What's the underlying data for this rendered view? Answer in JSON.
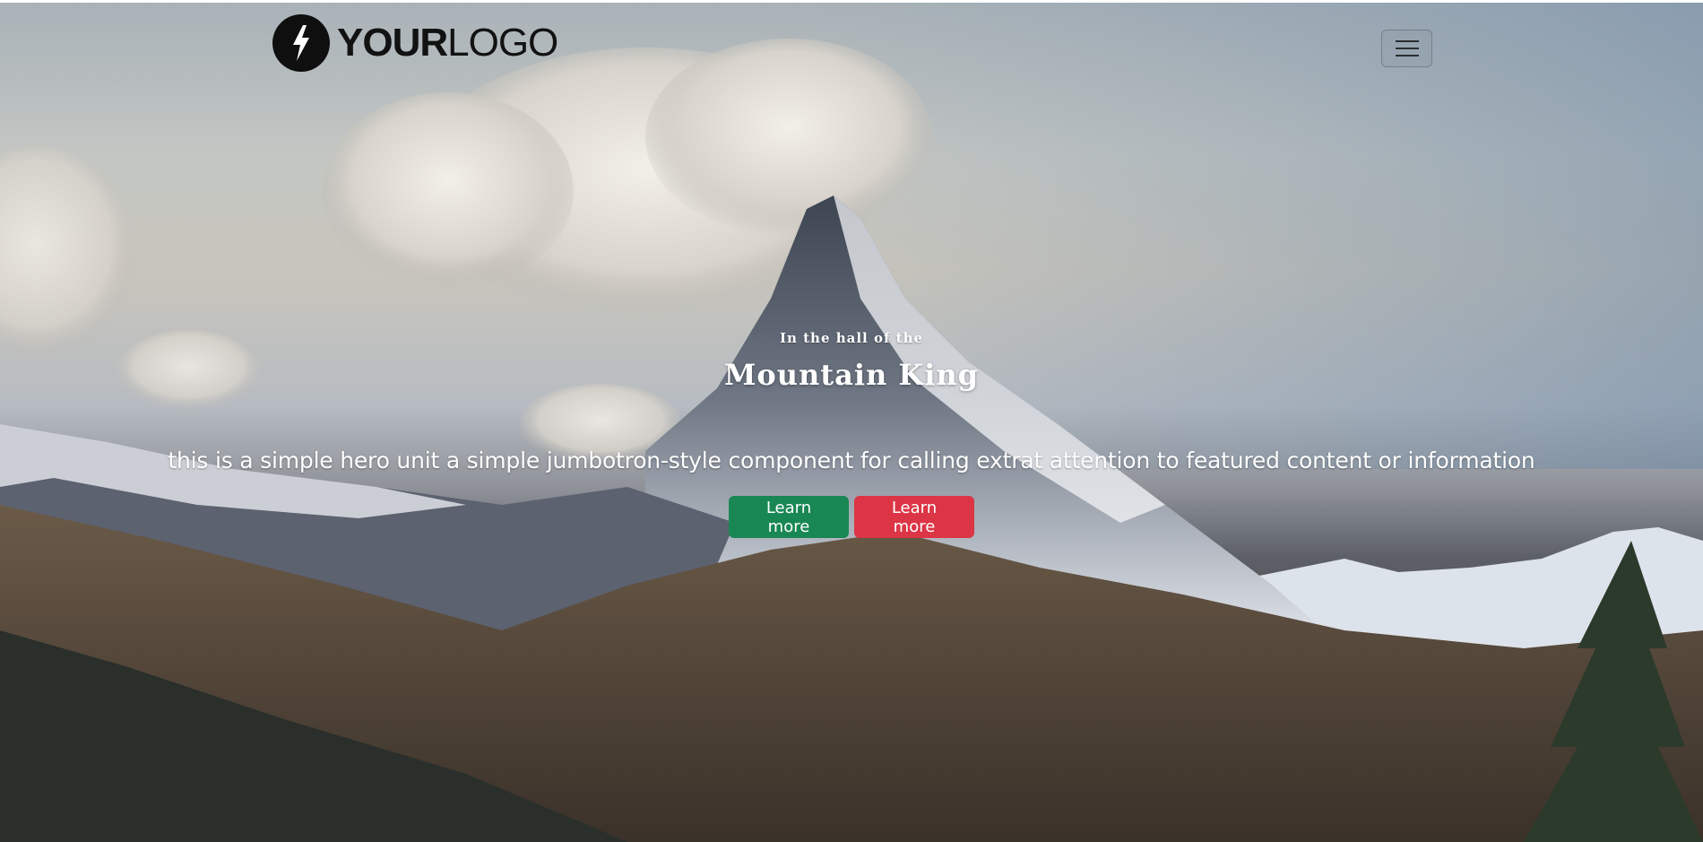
{
  "navbar": {
    "logo": {
      "text_bold": "YOUR",
      "text_light": "LOGO",
      "icon": "lightning-bolt-icon"
    },
    "menu_toggle": {
      "icon": "hamburger-menu-icon"
    }
  },
  "hero": {
    "eyebrow": "In the hall of the",
    "title": "Mountain King",
    "lead": "this is a simple hero unit a simple jumbotron-style component for calling extrat attention to featured content or information",
    "background": "mountain peak landscape photo",
    "buttons": [
      {
        "label": "Learn more",
        "color": "#198754"
      },
      {
        "label": "Learn more",
        "color": "#dc3545"
      }
    ]
  },
  "colors": {
    "success": "#198754",
    "danger": "#dc3545",
    "logo": "#111111"
  }
}
